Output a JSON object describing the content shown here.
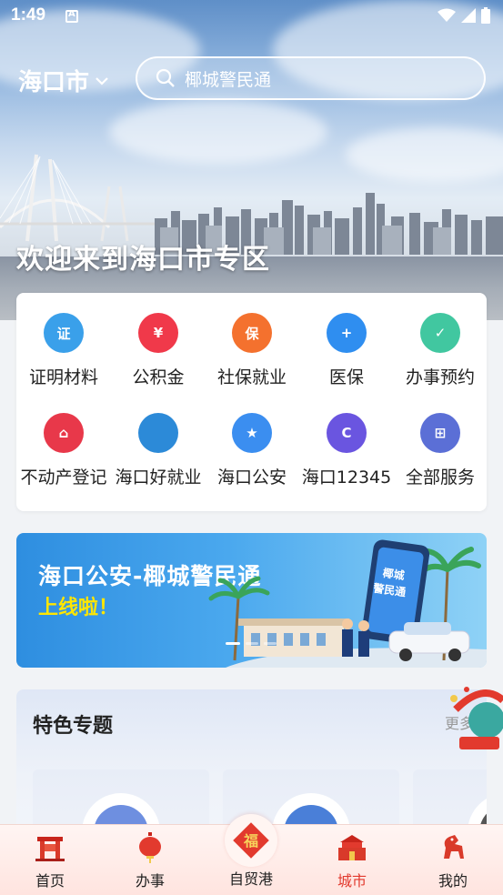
{
  "statusbar": {
    "time": "1:49"
  },
  "header": {
    "city": "海口市",
    "search_placeholder": "椰城警民通"
  },
  "hero": {
    "welcome": "欢迎来到海口市专区"
  },
  "services": [
    {
      "label": "证明材料",
      "icon": "certificate-icon",
      "color": "#3aa0ea",
      "glyph": "证"
    },
    {
      "label": "公积金",
      "icon": "housing-fund-icon",
      "color": "#f0394a",
      "glyph": "¥"
    },
    {
      "label": "社保就业",
      "icon": "social-security-icon",
      "color": "#f4712e",
      "glyph": "保"
    },
    {
      "label": "医保",
      "icon": "medical-insurance-icon",
      "color": "#2f8ef0",
      "glyph": "+"
    },
    {
      "label": "办事预约",
      "icon": "appointment-icon",
      "color": "#41c7a0",
      "glyph": "✓"
    },
    {
      "label": "不动产登记",
      "icon": "real-estate-icon",
      "color": "#e8384a",
      "glyph": "⌂"
    },
    {
      "label": "海口好就业",
      "icon": "haikou-employment-icon",
      "color": "#2c8ad8",
      "glyph": ""
    },
    {
      "label": "海口公安",
      "icon": "police-icon",
      "color": "#3b8ef0",
      "glyph": "★"
    },
    {
      "label": "海口12345",
      "icon": "hotline-12345-icon",
      "color": "#6a55e0",
      "glyph": "C"
    },
    {
      "label": "全部服务",
      "icon": "all-services-icon",
      "color": "#5b6fd6",
      "glyph": "⊞"
    }
  ],
  "banner": {
    "line1": "海口公安-椰城警民通",
    "line2": "上线啦！",
    "phone_text": "椰城警民通"
  },
  "featured": {
    "title": "特色专题",
    "more": "更多"
  },
  "bottom_nav": [
    {
      "label": "首页",
      "icon": "home-gate-icon",
      "active": false
    },
    {
      "label": "办事",
      "icon": "lantern-icon",
      "active": false
    },
    {
      "label": "自贸港",
      "icon": "fu-diamond-icon",
      "active": false
    },
    {
      "label": "城市",
      "icon": "city-building-icon",
      "active": true
    },
    {
      "label": "我的",
      "icon": "horse-icon",
      "active": false
    }
  ],
  "colors": {
    "accent": "#e23a2e",
    "primary_blue": "#2e8ee0"
  }
}
